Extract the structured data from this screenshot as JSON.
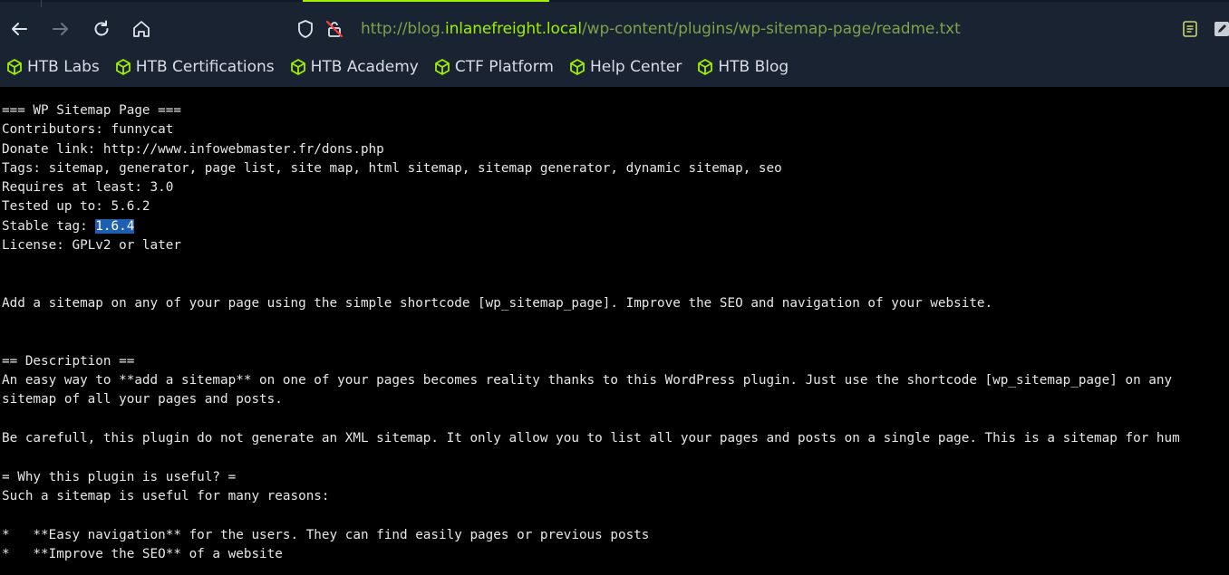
{
  "browser": {
    "url_prefix": "http://blog.",
    "url_host": "inlanefreight.local",
    "url_path": "/wp-content/plugins/wp-sitemap-page/readme.txt",
    "accent": "#9fef00"
  },
  "bookmarks": [
    {
      "label": "HTB Labs",
      "icon": "cube-icon"
    },
    {
      "label": "HTB Certifications",
      "icon": "cube-icon"
    },
    {
      "label": "HTB Academy",
      "icon": "cube-icon"
    },
    {
      "label": "CTF Platform",
      "icon": "cube-icon"
    },
    {
      "label": "Help Center",
      "icon": "cube-icon"
    },
    {
      "label": "HTB Blog",
      "icon": "cube-icon"
    }
  ],
  "readme": {
    "title": "=== WP Sitemap Page ===",
    "contributors": "Contributors: funnycat",
    "donate": "Donate link: http://www.infowebmaster.fr/dons.php",
    "tags": "Tags: sitemap, generator, page list, site map, html sitemap, sitemap generator, dynamic sitemap, seo",
    "requires": "Requires at least: 3.0",
    "tested": "Tested up to: 5.6.2",
    "stable_prefix": "Stable tag: ",
    "stable_value": "1.6.4",
    "license": "License: GPLv2 or later",
    "summary": "Add a sitemap on any of your page using the simple shortcode [wp_sitemap_page]. Improve the SEO and navigation of your website.",
    "desc_heading": "== Description ==",
    "desc_line1": "An easy way to **add a sitemap** on one of your pages becomes reality thanks to this WordPress plugin. Just use the shortcode [wp_sitemap_page] on any",
    "desc_line2": "sitemap of all your pages and posts.",
    "careful": "Be carefull, this plugin do not generate an XML sitemap. It only allow you to list all your pages and posts on a single page. This is a sitemap for hum",
    "why_heading": "= Why this plugin is useful? =",
    "why_intro": "Such a sitemap is useful for many reasons:",
    "bullet1": "*   **Easy navigation** for the users. They can find easily pages or previous posts",
    "bullet2": "*   **Improve the SEO** of a website"
  }
}
